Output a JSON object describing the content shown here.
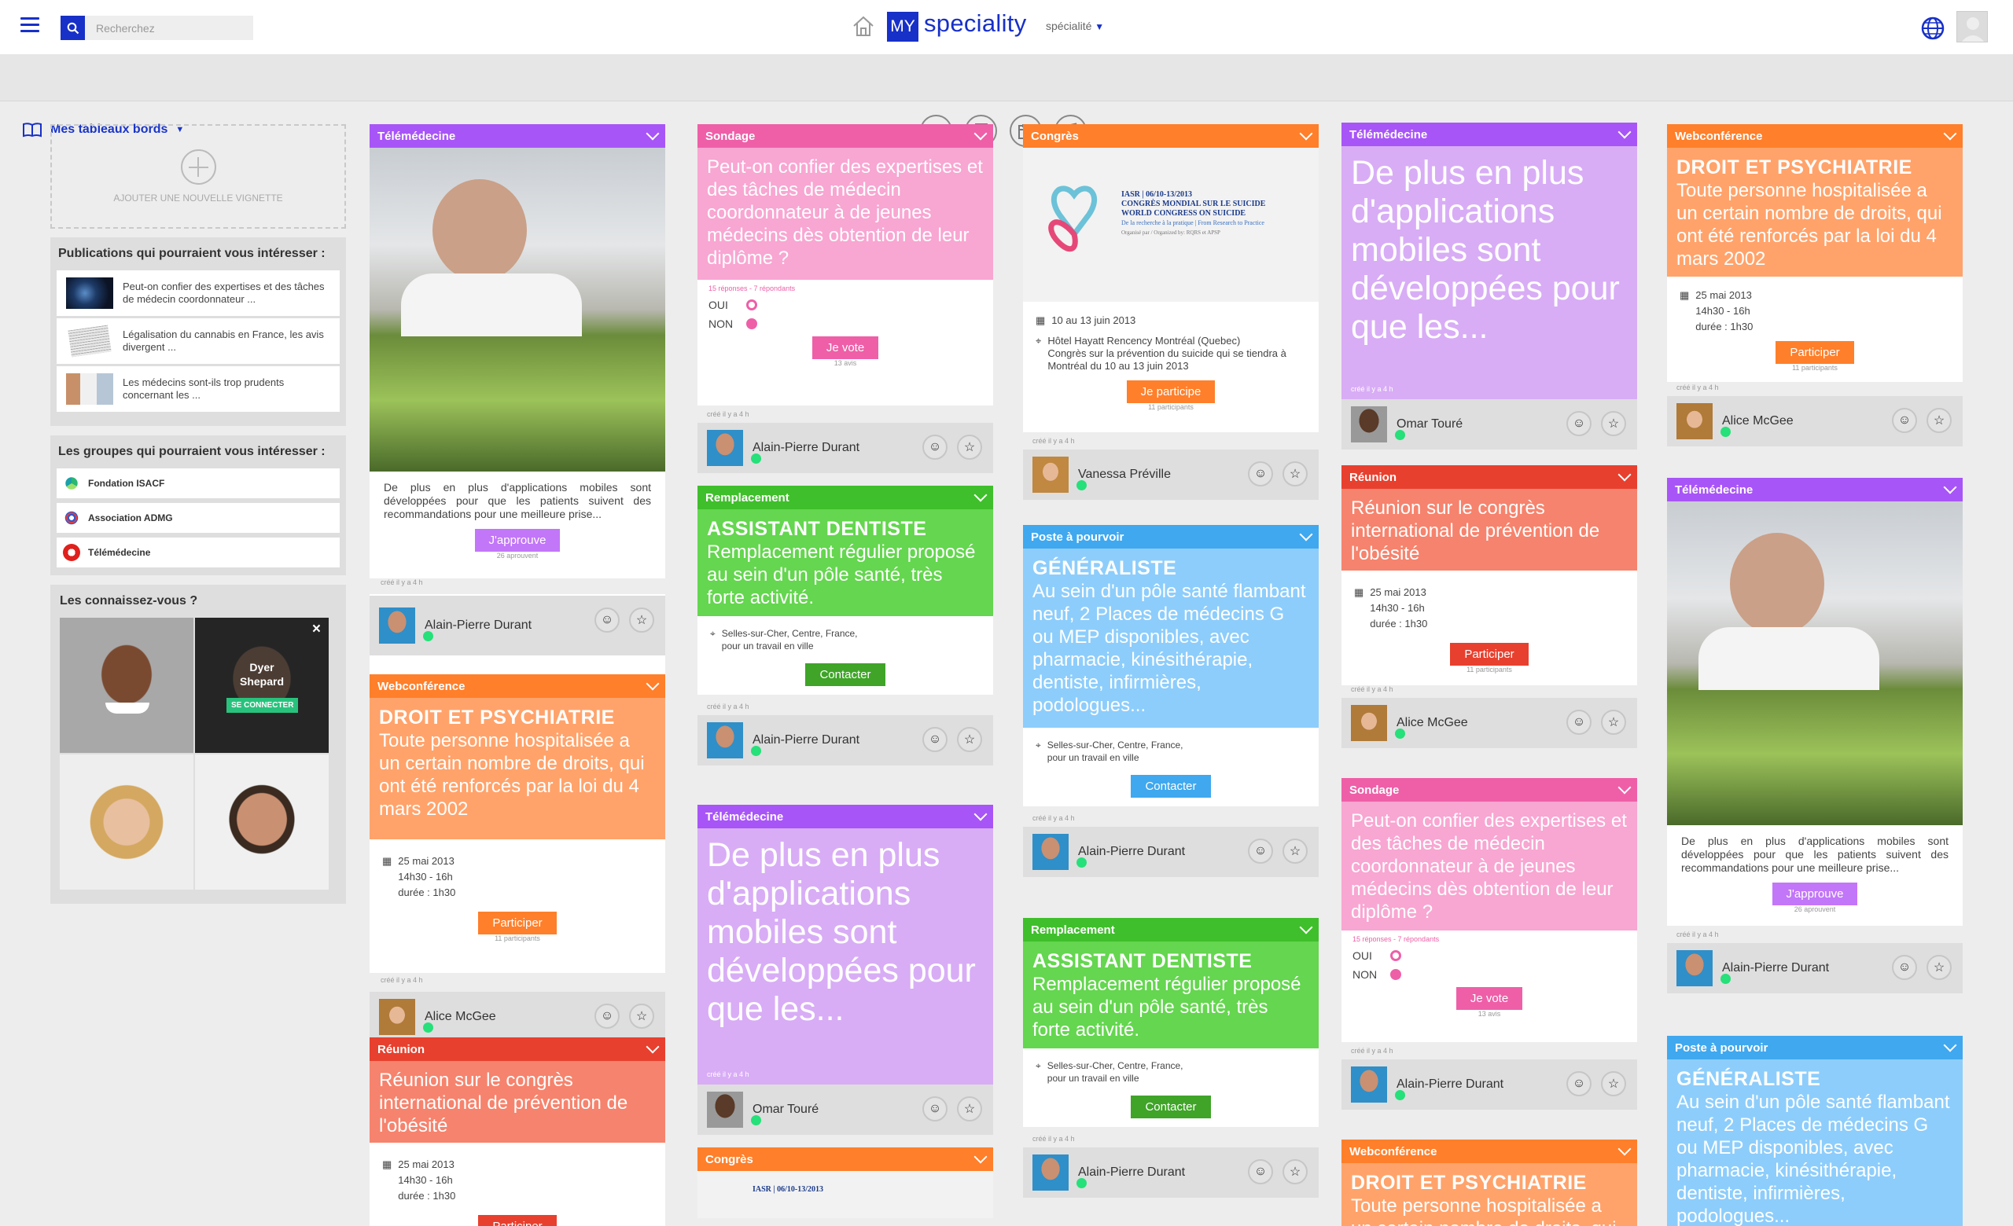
{
  "header": {
    "search_placeholder": "Recherchez",
    "logo_my": "MY",
    "logo_speciality": "speciality",
    "specialty_select": "spécialité"
  },
  "subbar": {
    "dashboard_label": "Mes tableaux bords"
  },
  "left": {
    "add_tile_label": "AJOUTER UNE NOUVELLE VIGNETTE",
    "publications": {
      "title": "Publications qui pourraient vous intéresser :",
      "items": [
        "Peut-on confier des  expertises et des tâches de médecin coordonnateur ...",
        "Légalisation du cannabis en France, les avis divergent ...",
        "Les médecins sont-ils trop prudents concernant les ..."
      ]
    },
    "groups": {
      "title": "Les groupes qui pourraient vous intéresser :",
      "items": [
        "Fondation ISACF",
        "Association ADMG",
        "Télémédecine"
      ]
    },
    "know": {
      "title": "Les connaissez-vous ?",
      "name": "Dyer Shepard",
      "connect": "SE CONNECTER",
      "close": "×"
    }
  },
  "cards": {
    "tele": {
      "header": "Télémédecine",
      "description": "De plus en plus d'applications mobiles sont développées pour que les patients suivent des recommandations pour une meilleure prise...",
      "button": "J'approuve",
      "count": "26 aprouvent",
      "created": "créé il y a 4 h",
      "user": "Alain-Pierre Durant"
    },
    "web": {
      "header": "Webconférence",
      "title": "DROIT ET PSYCHIATRIE",
      "text": "Toute personne hospitalisée a un certain nombre de droits, qui ont été renforcés par la loi du 4 mars 2002",
      "date": "25 mai 2013",
      "time": "14h30 - 16h",
      "duration": "durée : 1h30",
      "button": "Participer",
      "count": "11 participants",
      "created": "créé il y a 4 h",
      "user": "Alice McGee"
    },
    "reunion": {
      "header": "Réunion",
      "text": "Réunion sur le congrès international de prévention de l'obésité",
      "date": "25 mai 2013",
      "time": "14h30 - 16h",
      "duration": "durée : 1h30",
      "button": "Participer",
      "count": "11 participants",
      "created": "créé il y a 4 h",
      "user": "Alice McGee"
    },
    "sondage": {
      "header": "Sondage",
      "text": "Peut-on confier des expertises et des tâches de médecin coordonnateur à de jeunes médecins dès obtention de leur diplôme ?",
      "stats": "15 réponses - 7 répondants",
      "oui": "OUI",
      "non": "NON",
      "button": "Je vote",
      "count": "13 avis",
      "created": "créé il y a 4 h",
      "user": "Alain-Pierre Durant"
    },
    "remp": {
      "header": "Remplacement",
      "title": "ASSISTANT DENTISTE",
      "text": "Remplacement régulier proposé au sein d'un pôle santé, très forte activité.",
      "location1": "Selles-sur-Cher, Centre, France,",
      "location2": "pour un travail en ville",
      "button": "Contacter",
      "created": "créé il y a 4 h",
      "user": "Alain-Pierre Durant"
    },
    "tele2": {
      "header": "Télémédecine",
      "text": "De plus en plus d'applications mobiles sont développées pour que les...",
      "created": "créé il y a 4 h",
      "user": "Omar Touré"
    },
    "congres": {
      "header": "Congrès",
      "banner_iasr": "IASR | 06/10-13/2013",
      "banner_l1": "CONGRÈS MONDIAL SUR LE SUICIDE",
      "banner_l2": "WORLD CONGRESS ON SUICIDE",
      "banner_l3": "De la recherche à la pratique | From Research to Practice",
      "banner_l4": "Organisé par / Organized by: RQRS et APSP",
      "date": "10 au 13 juin 2013",
      "place": "Hôtel Hayatt Rencency Montréal (Quebec)",
      "text": "Congrès sur la prévention du suicide qui se tiendra à Montréal du 10 au 13 juin 2013",
      "button": "Je participe",
      "count": "11 participants",
      "created": "créé il y a 4 h",
      "user": "Vanessa Préville"
    },
    "poste": {
      "header": "Poste à pourvoir",
      "title": "GÉNÉRALISTE",
      "text": "Au sein d'un pôle santé flambant neuf, 2 Places de médecins G ou MEP disponibles, avec pharmacie, kinésithérapie, dentiste, infirmières, podologues...",
      "location1": "Selles-sur-Cher, Centre, France,",
      "location2": "pour un travail en ville",
      "button": "Contacter",
      "created": "créé il y a 4 h",
      "user": "Alain-Pierre Durant"
    }
  },
  "colors": {
    "blue": "#1730c8",
    "purple": "#a855f7",
    "purple_light": "#d8adf5",
    "pink": "#ee5fa8",
    "pink_light": "#f8a6d2",
    "green": "#3fbf2b",
    "green_light": "#64d64f",
    "orange": "#ff7f2a",
    "orange_light": "#ffa36b",
    "red": "#e8402e",
    "red_light": "#f6836d",
    "lightblue": "#3fa8ef",
    "lightblue_light": "#8dcdfb"
  }
}
